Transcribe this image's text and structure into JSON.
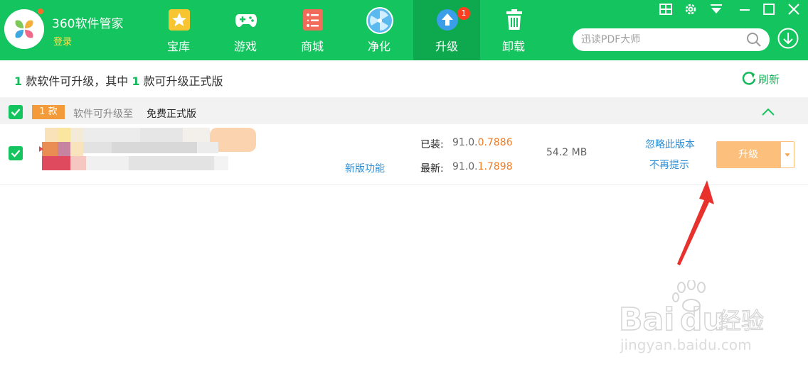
{
  "app": {
    "title": "360软件管家",
    "login_label": "登录"
  },
  "tabs": [
    {
      "label": "宝库",
      "icon": "star-icon"
    },
    {
      "label": "游戏",
      "icon": "gamepad-icon"
    },
    {
      "label": "商城",
      "icon": "store-icon"
    },
    {
      "label": "净化",
      "icon": "fan-icon"
    },
    {
      "label": "升级",
      "icon": "upgrade-arrow-icon",
      "badge": "1",
      "active": true
    },
    {
      "label": "卸载",
      "icon": "trash-icon"
    }
  ],
  "search": {
    "placeholder": "迅读PDF大师"
  },
  "summary": {
    "count1": "1",
    "text1": " 款软件可升级，其中 ",
    "count2": "1",
    "text2": " 款可升级正式版",
    "refresh_label": "刷新"
  },
  "group": {
    "count_badge": "1 款",
    "text": "软件可升级至",
    "edition": "免费正式版"
  },
  "item": {
    "new_features_label": "新版功能",
    "installed_label": "已装:",
    "installed_prefix": "91.0.",
    "installed_highlight": "0.7886",
    "latest_label": "最新:",
    "latest_prefix": "91.0.",
    "latest_highlight": "1.7898",
    "size": "54.2 MB",
    "ignore_label": "忽略此版本",
    "no_remind_label": "不再提示",
    "upgrade_label": "升级"
  },
  "colors": {
    "brand_green": "#14c45e",
    "active_tab": "#0ea94f",
    "accent_orange": "#f39a3b",
    "upgrade_button": "#fdc07c",
    "link_blue": "#2d8fd6",
    "annotation_red": "#e8312c"
  },
  "watermark": {
    "logo_text": "Baidu经验",
    "url_text": "jingyan.baidu.com"
  }
}
